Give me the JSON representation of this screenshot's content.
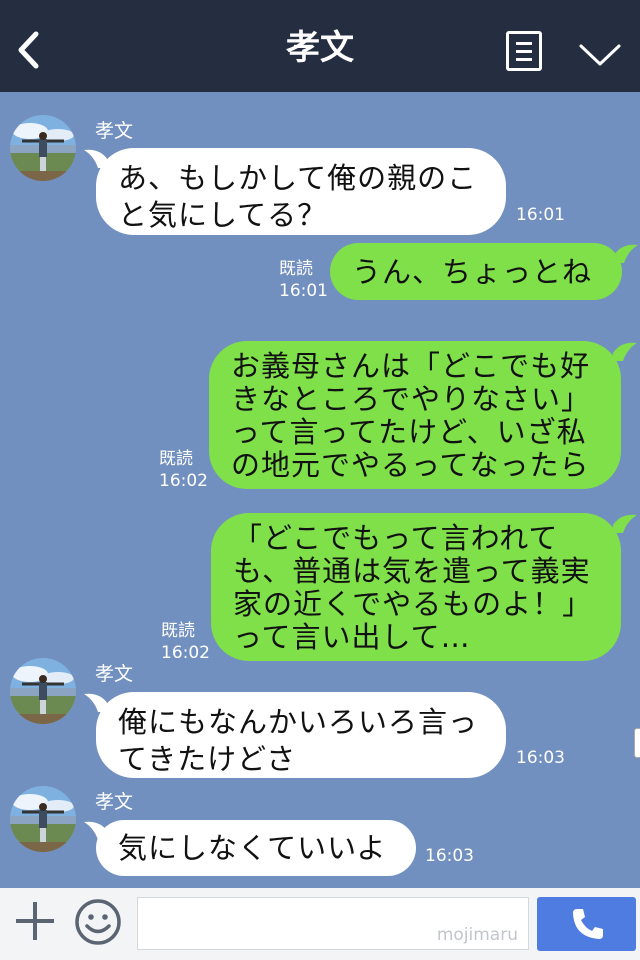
{
  "header": {
    "title": "孝文"
  },
  "messages": [
    {
      "side": "in",
      "sender": "孝文",
      "lines": [
        "あ、もしかして俺の親のこ",
        "と気にしてる？"
      ],
      "time": "16:01"
    },
    {
      "side": "out",
      "read": "既読",
      "lines": [
        "うん、ちょっとね"
      ],
      "time": "16:01"
    },
    {
      "side": "out",
      "read": "既読",
      "lines": [
        "お義母さんは「どこでも好",
        "きなところでやりなさい」",
        "って言ってたけど、いざ私",
        "の地元でやるってなったら"
      ],
      "time": "16:02"
    },
    {
      "side": "out",
      "read": "既読",
      "lines": [
        "「どこでもって言われて",
        "も、普通は気を遣って義実",
        "家の近くでやるものよ！」",
        "って言い出して…"
      ],
      "time": "16:02"
    },
    {
      "side": "in",
      "sender": "孝文",
      "lines": [
        "俺にもなんかいろいろ言っ",
        "てきたけどさ"
      ],
      "time": "16:03"
    },
    {
      "side": "in",
      "sender": "孝文",
      "lines": [
        "気にしなくていいよ"
      ],
      "time": "16:03"
    }
  ],
  "input": {
    "watermark": "mojimaru"
  },
  "icons": [
    "back-icon",
    "menu-icon",
    "chevron-down-icon",
    "avatar",
    "plus-icon",
    "smile-icon",
    "phone-icon"
  ],
  "colors": {
    "header": "#252d40",
    "chat_bg": "#7290bf",
    "bubble_in": "#ffffff",
    "bubble_out": "#7fe04a",
    "call_button": "#4e7ce1"
  }
}
